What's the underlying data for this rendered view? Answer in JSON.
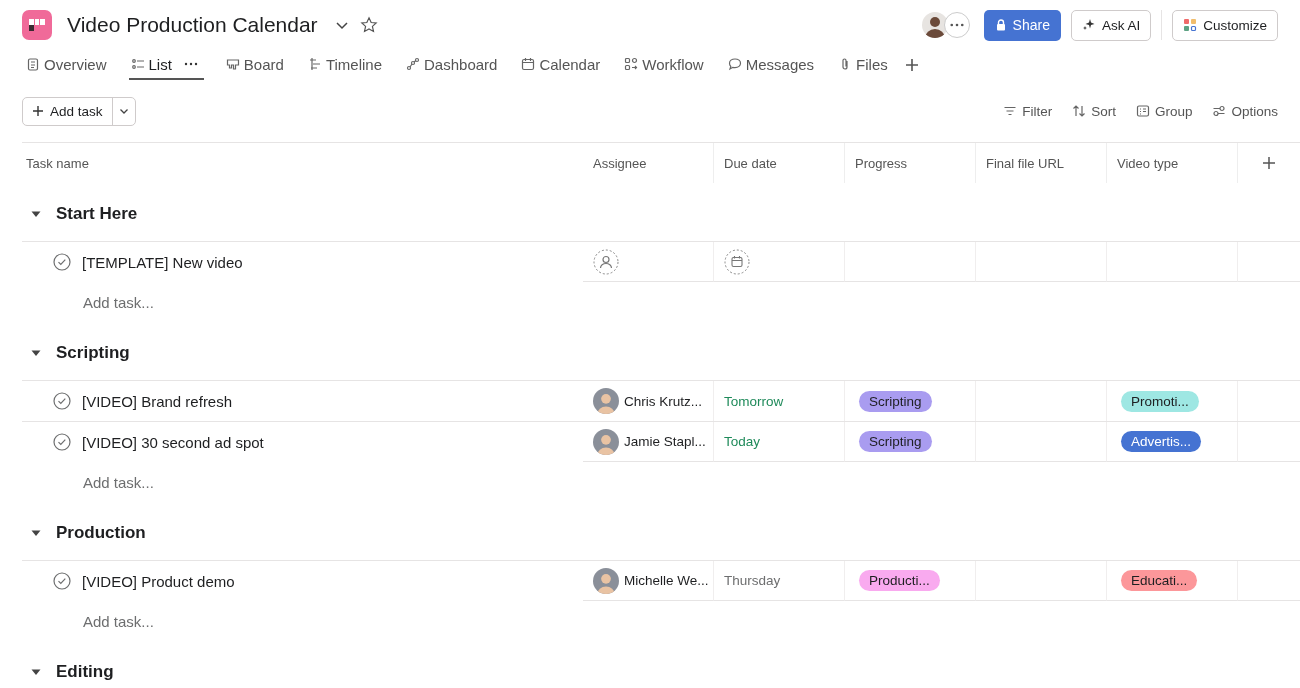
{
  "project": {
    "title": "Video Production Calendar",
    "starred": false
  },
  "header_actions": {
    "share": "Share",
    "ask_ai": "Ask AI",
    "customize": "Customize"
  },
  "tabs": [
    {
      "label": "Overview",
      "selected": false
    },
    {
      "label": "List",
      "selected": true
    },
    {
      "label": "Board",
      "selected": false
    },
    {
      "label": "Timeline",
      "selected": false
    },
    {
      "label": "Dashboard",
      "selected": false
    },
    {
      "label": "Calendar",
      "selected": false
    },
    {
      "label": "Workflow",
      "selected": false
    },
    {
      "label": "Messages",
      "selected": false
    },
    {
      "label": "Files",
      "selected": false
    }
  ],
  "toolbar": {
    "add_task": "Add task",
    "actions": [
      "Filter",
      "Sort",
      "Group",
      "Options"
    ]
  },
  "table": {
    "columns": [
      "Task name",
      "Assignee",
      "Due date",
      "Progress",
      "Final file URL",
      "Video type"
    ],
    "sections": [
      {
        "name": "Start Here",
        "expanded": true,
        "add_task": "Add task...",
        "tasks": [
          {
            "name": "[TEMPLATE] New video"
          }
        ]
      },
      {
        "name": "Scripting",
        "expanded": true,
        "add_task": "Add task...",
        "tasks": [
          {
            "name": "[VIDEO] Brand refresh",
            "assignee": "Chris Krutz...",
            "due": {
              "text": "Tomorrow",
              "color": "#1f8a5a"
            },
            "progress": {
              "text": "Scripting",
              "color": "#a99cf0"
            },
            "video_type": {
              "text": "Promoti...",
              "color": "#9ee7e3"
            }
          },
          {
            "name": "[VIDEO] 30 second ad spot",
            "assignee": "Jamie Stapl...",
            "due": {
              "text": "Today",
              "color": "#1f8a5a"
            },
            "progress": {
              "text": "Scripting",
              "color": "#a99cf0"
            },
            "video_type": {
              "text": "Advertis...",
              "color": "#4573d2"
            }
          }
        ]
      },
      {
        "name": "Production",
        "expanded": true,
        "add_task": "Add task...",
        "tasks": [
          {
            "name": "[VIDEO] Product demo",
            "assignee": "Michelle We...",
            "due": {
              "text": "Thursday",
              "color": "#6d6e6f"
            },
            "progress": {
              "text": "Producti...",
              "color": "#f9aaef"
            },
            "video_type": {
              "text": "Educati...",
              "color": "#fc979a"
            }
          }
        ]
      },
      {
        "name": "Editing",
        "expanded": true
      }
    ]
  }
}
